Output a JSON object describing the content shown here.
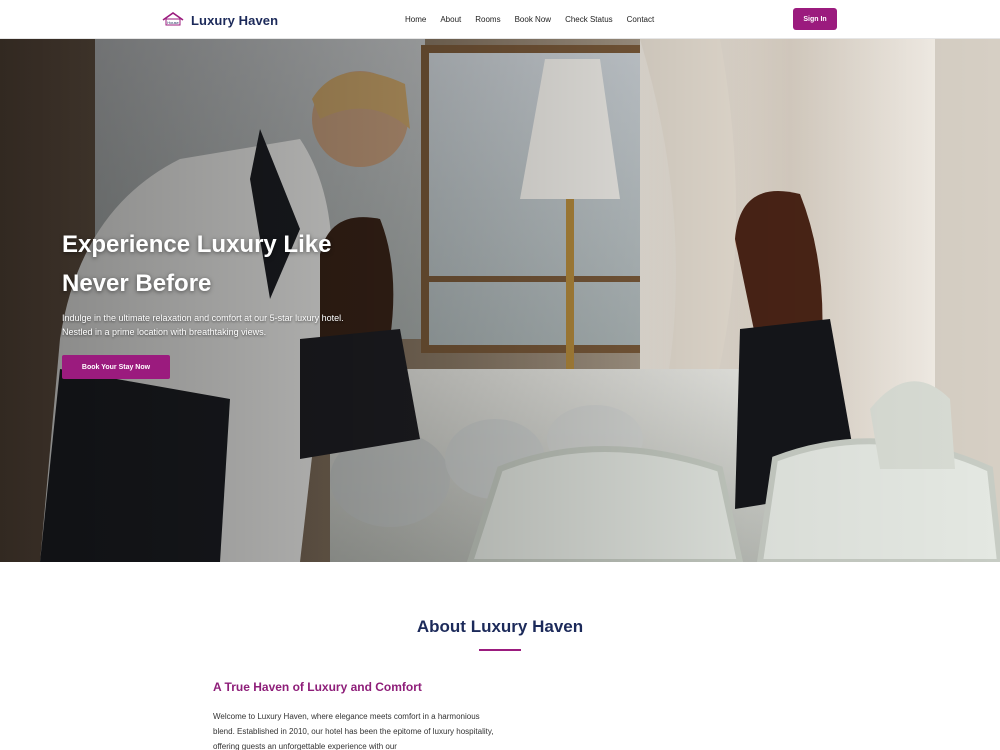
{
  "navbar": {
    "brand": "Luxury Haven",
    "logo_text": "House",
    "links": [
      "Home",
      "About",
      "Rooms",
      "Book Now",
      "Check Status",
      "Contact"
    ],
    "signin": "Sign In",
    "accent_color": "#9b1b7e",
    "brand_color": "#1c2a5a"
  },
  "hero": {
    "title_line1": "Experience Luxury Like",
    "title_line2": "Never Before",
    "text": "Indulge in the ultimate relaxation and comfort at our 5-star luxury hotel. Nestled in a prime location with breathtaking views.",
    "cta": "Book Your Stay Now",
    "image": "restaurant-dining-photo"
  },
  "about": {
    "title": "About Luxury Haven",
    "subtitle": "A True Haven of Luxury and Comfort",
    "body": "Welcome to Luxury Haven, where elegance meets comfort in a harmonious blend. Established in 2010, our hotel has been the epitome of luxury hospitality, offering guests an unforgettable experience with our"
  }
}
